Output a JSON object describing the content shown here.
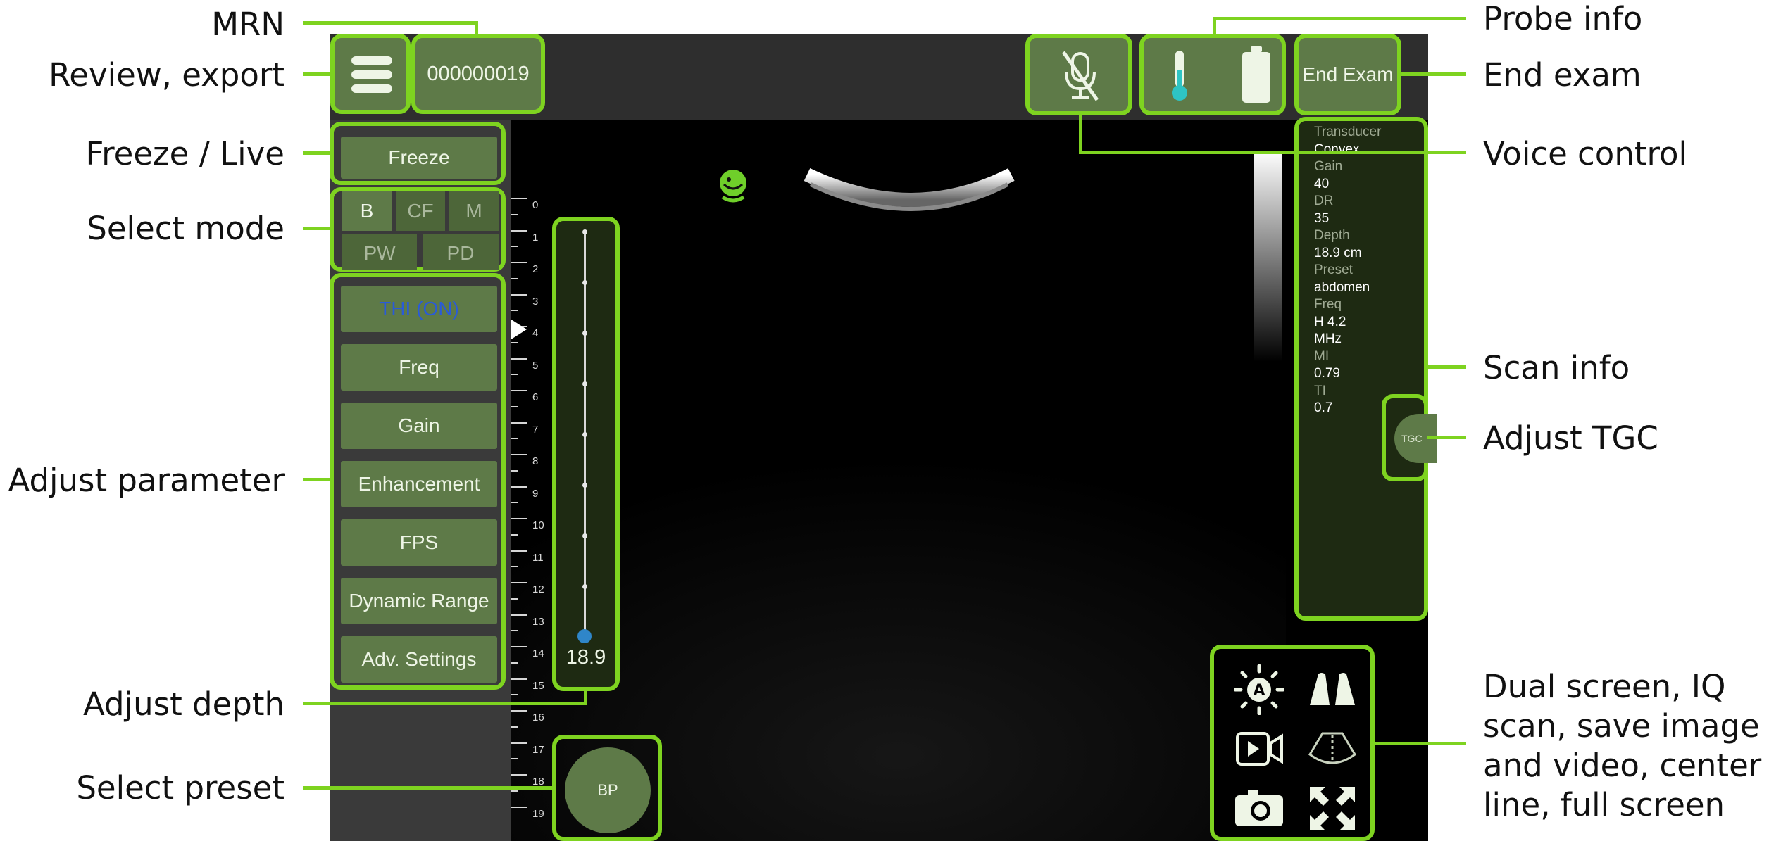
{
  "callouts": {
    "mrn": "MRN",
    "review_export": "Review, export",
    "freeze_live": "Freeze / Live",
    "select_mode": "Select mode",
    "adjust_parameter": "Adjust parameter",
    "adjust_depth": "Adjust depth",
    "select_preset": "Select preset",
    "probe_info": "Probe info",
    "end_exam": "End exam",
    "voice_control": "Voice control",
    "scan_info": "Scan info",
    "adjust_tgc": "Adjust TGC",
    "bottom_tools": [
      "Dual screen, IQ",
      "scan, save image",
      "and video, center",
      "line, full screen"
    ]
  },
  "topbar": {
    "mrn_value": "000000019",
    "end_exam_label": "End Exam",
    "icons": [
      "menu-icon",
      "mic-off-icon",
      "thermometer-icon",
      "battery-icon"
    ]
  },
  "freeze_label": "Freeze",
  "modes": [
    {
      "label": "B",
      "active": true
    },
    {
      "label": "CF",
      "active": false
    },
    {
      "label": "M",
      "active": false
    },
    {
      "label": "PW",
      "active": false
    },
    {
      "label": "PD",
      "active": false
    }
  ],
  "parameters": [
    "THI (ON)",
    "Freq",
    "Gain",
    "Enhancement",
    "FPS",
    "Dynamic Range",
    "Adv. Settings"
  ],
  "depth": {
    "value": "18.9",
    "ruler_labels": [
      "0",
      "1",
      "2",
      "3",
      "4",
      "5",
      "6",
      "7",
      "8",
      "9",
      "10",
      "11",
      "12",
      "13",
      "14",
      "15",
      "16",
      "17",
      "18",
      "19"
    ]
  },
  "preset_button_label": "BP",
  "tgc_label": "TGC",
  "scan_info": [
    {
      "label": "Transducer",
      "value": "Convex"
    },
    {
      "label": "Gain",
      "value": "40"
    },
    {
      "label": "DR",
      "value": "35"
    },
    {
      "label": "Depth",
      "value": "18.9 cm"
    },
    {
      "label": "Preset",
      "value": "abdomen"
    },
    {
      "label": "Freq",
      "value": "H 4.2"
    },
    {
      "label": "",
      "value": "MHz"
    },
    {
      "label": "MI",
      "value": "0.79"
    },
    {
      "label": "TI",
      "value": "0.7"
    }
  ],
  "bottom_tool_icons": [
    "auto-brightness-icon",
    "dual-screen-icon",
    "video-record-icon",
    "center-line-icon",
    "camera-icon",
    "fullscreen-icon"
  ],
  "colors": {
    "highlight": "#7ed320",
    "button": "#5e7a48",
    "thi_text": "#2a5bd7",
    "thermo": "#2ec4c4"
  }
}
